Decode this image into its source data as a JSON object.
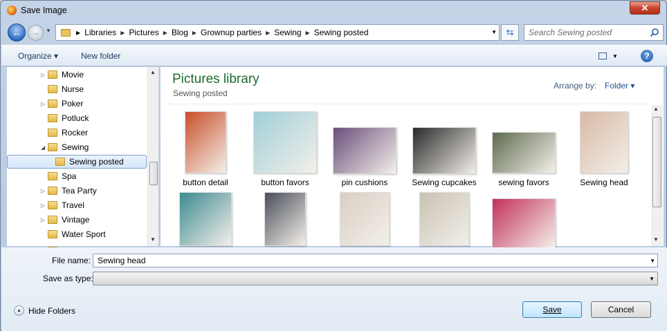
{
  "window": {
    "title": "Save Image",
    "close_label": "✕"
  },
  "address": {
    "crumbs": [
      "Libraries",
      "Pictures",
      "Blog",
      "Grownup parties",
      "Sewing",
      "Sewing posted"
    ],
    "search_placeholder": "Search Sewing posted"
  },
  "toolbar": {
    "organize": "Organize ▾",
    "new_folder": "New folder",
    "help": "?"
  },
  "tree": {
    "items": [
      {
        "label": "Movie",
        "expand": "▷"
      },
      {
        "label": "Nurse",
        "expand": ""
      },
      {
        "label": "Poker",
        "expand": "▷"
      },
      {
        "label": "Potluck",
        "expand": ""
      },
      {
        "label": "Rocker",
        "expand": ""
      },
      {
        "label": "Sewing",
        "expand": "◢"
      },
      {
        "label": "Sewing posted",
        "expand": ""
      },
      {
        "label": "Spa",
        "expand": ""
      },
      {
        "label": "Tea Party",
        "expand": "▷"
      },
      {
        "label": "Travel",
        "expand": "▷"
      },
      {
        "label": "Vintage",
        "expand": "▷"
      },
      {
        "label": "Water Sport",
        "expand": ""
      }
    ]
  },
  "library": {
    "title": "Pictures library",
    "subtitle": "Sewing posted",
    "arrange_label": "Arrange by:",
    "arrange_value": "Folder ▾"
  },
  "files": [
    {
      "name": "button detail",
      "color": "#c94f2a"
    },
    {
      "name": "button favors",
      "color": "#9fcfd8"
    },
    {
      "name": "pin cushions",
      "color": "#6a4f7c"
    },
    {
      "name": "Sewing cupcakes",
      "color": "#2a2a2a"
    },
    {
      "name": "sewing favors",
      "color": "#5e6b4f"
    },
    {
      "name": "Sewing head",
      "color": "#d8b9a4"
    },
    {
      "name": "",
      "color": "#3e8a91"
    },
    {
      "name": "",
      "color": "#4a4f5a"
    },
    {
      "name": "",
      "color": "#d9cfc4"
    },
    {
      "name": "",
      "color": "#c9c2b3"
    },
    {
      "name": "",
      "color": "#c3305a"
    }
  ],
  "bottom": {
    "file_name_label": "File name:",
    "file_name_value": "Sewing head",
    "save_type_label": "Save as type:",
    "hide_folders": "Hide Folders",
    "save": "Save",
    "cancel": "Cancel"
  }
}
